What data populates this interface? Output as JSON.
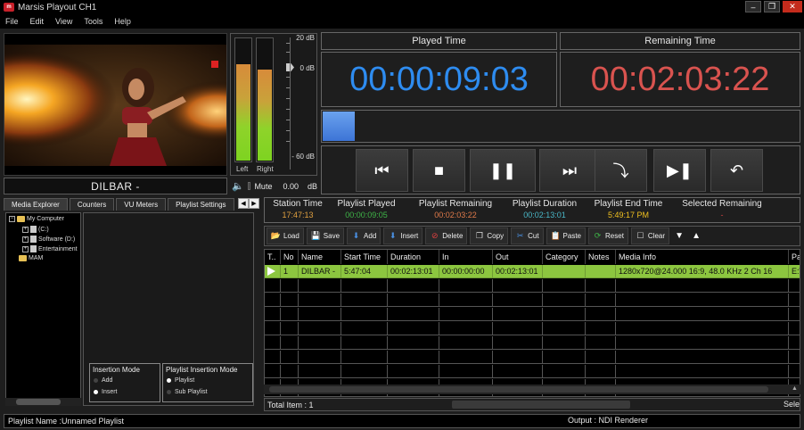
{
  "window": {
    "title": "Marsis Playout CH1",
    "logo": "m-logo",
    "controls": [
      "minimize-icon",
      "restore-icon",
      "close-icon"
    ]
  },
  "menu": [
    "File",
    "Edit",
    "View",
    "Tools",
    "Help"
  ],
  "preview": {
    "clip_name": "DILBAR -"
  },
  "audio": {
    "left_label": "Left",
    "right_label": "Right",
    "left_level": 0.78,
    "right_level": 0.74,
    "scale": [
      "20 dB",
      "0 dB",
      "- 60 dB"
    ],
    "mute_label": "Mute",
    "volume": "0.00",
    "volume_unit": "dB"
  },
  "times": {
    "played_label": "Played Time",
    "played_value": "00:00:09:03",
    "played_color": "#2e8cf0",
    "remaining_label": "Remaining Time",
    "remaining_value": "00:02:03:22",
    "remaining_color": "#d9534f",
    "progress": 0.068
  },
  "transport": [
    "previous-icon",
    "stop-icon",
    "pause-icon",
    "next-icon",
    "skip-icon",
    "play-next-icon",
    "undo-icon"
  ],
  "tabs": [
    "Media Explorer",
    "Counters",
    "VU Meters",
    "Playlist Settings"
  ],
  "tree": {
    "root": "My Computer",
    "items": [
      "(C:)",
      "Software (D:)",
      "Entertainment"
    ],
    "mam": "MAM"
  },
  "insertion_mode": {
    "title": "Insertion Mode",
    "options": [
      "Add",
      "Insert"
    ],
    "selected": "Insert"
  },
  "playlist_insertion_mode": {
    "title": "Playlist Insertion Mode",
    "options": [
      "Playlist",
      "Sub Playlist"
    ],
    "selected": "Playlist"
  },
  "info": {
    "station_time_label": "Station Time",
    "station_time": "17:47:13",
    "playlist_played_label": "Playlist Played",
    "playlist_played": "00:00:09:05",
    "playlist_remaining_label": "Playlist Remaining",
    "playlist_remaining": "00:02:03:22",
    "playlist_duration_label": "Playlist Duration",
    "playlist_duration": "00:02:13:01",
    "playlist_end_label": "Playlist End Time",
    "playlist_end": "5:49:17 PM",
    "selected_remaining_label": "Selected Remaining",
    "selected_remaining": "-"
  },
  "playlist_toolbar": [
    "Load",
    "Save",
    "Add",
    "Insert",
    "Delete",
    "Copy",
    "Cut",
    "Paste",
    "Reset",
    "Clear"
  ],
  "grid": {
    "columns": [
      "T..",
      "No",
      "Name",
      "Start Time",
      "Duration",
      "In",
      "Out",
      "Category",
      "Notes",
      "Media Info",
      "Pa"
    ],
    "rows": [
      [
        "",
        "1",
        "DILBAR -",
        "5:47:04",
        "00:02:13:01",
        "00:00:00:00",
        "00:02:13:01",
        "",
        "",
        "1280x720@24.000  16:9, 48.0 KHz 2 Ch 16",
        "E:\\"
      ]
    ]
  },
  "footer": {
    "total_items": "Total Item : 1",
    "selected": "Sele"
  },
  "status": {
    "playlist_name": "Playlist Name :Unnamed Playlist",
    "output": "Output : NDI Renderer"
  }
}
